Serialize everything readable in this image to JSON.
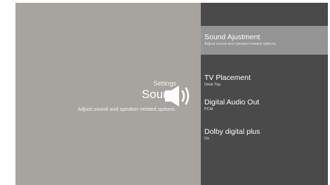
{
  "left_panel": {
    "kicker": "Settings",
    "title": "Sound",
    "description": "Adjust sound and speaker-related options.",
    "icon": "speaker-volume-icon"
  },
  "menu": {
    "items": [
      {
        "label": "Sound Ajustment",
        "subtitle": "Adjust sound and speaker-related options.",
        "selected": true
      },
      {
        "label": "TV Placement",
        "subtitle": "Desk Top."
      },
      {
        "label": "Digital Audio Out",
        "subtitle": "PCM"
      },
      {
        "label": "Dolby digital plus",
        "subtitle": "On"
      }
    ]
  },
  "colors": {
    "left_bg": "#a7a49f",
    "right_bg": "#4a4a4a",
    "selected_bg": "#949494",
    "text": "#ffffff"
  }
}
